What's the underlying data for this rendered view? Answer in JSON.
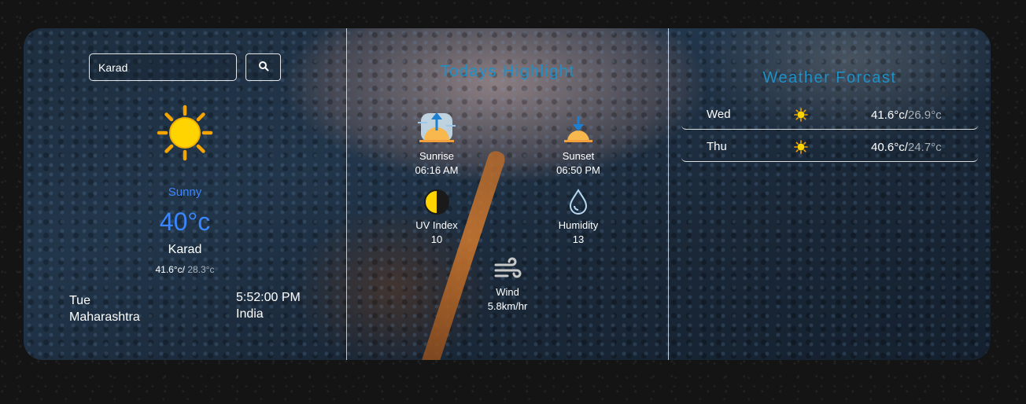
{
  "search": {
    "value": "Karad",
    "button_icon": "search-icon"
  },
  "current": {
    "icon": "sun-icon",
    "condition": "Sunny",
    "temperature": "40°c",
    "city": "Karad",
    "max": "41.6°c/",
    "min": " 28.3°c",
    "day": "Tue",
    "state": "Maharashtra",
    "time": "5:52:00 PM",
    "country": "India"
  },
  "highlights": {
    "title": "Todays Highlight",
    "sunrise": {
      "label": "Sunrise",
      "value": "06:16 AM",
      "icon": "sunrise-icon"
    },
    "sunset": {
      "label": "Sunset",
      "value": "06:50 PM",
      "icon": "sunset-icon"
    },
    "uv": {
      "label": "UV Index",
      "value": "10",
      "icon": "uv-index-icon"
    },
    "humidity": {
      "label": "Humidity",
      "value": "13",
      "icon": "humidity-drop-icon"
    },
    "wind": {
      "label": "Wind",
      "value": "5.8km/hr",
      "icon": "wind-icon"
    }
  },
  "forecast": {
    "title": "Weather Forcast",
    "days": [
      {
        "day": "Wed",
        "icon": "sun-icon",
        "max": "41.6°c/",
        "min": "26.9°c"
      },
      {
        "day": "Thu",
        "icon": "sun-icon",
        "max": "40.6°c/",
        "min": "24.7°c"
      }
    ]
  },
  "colors": {
    "accent": "#3a86ff",
    "heading": "#1e90c8",
    "sun": "#ffd400",
    "sun_ray": "#f5a400"
  }
}
